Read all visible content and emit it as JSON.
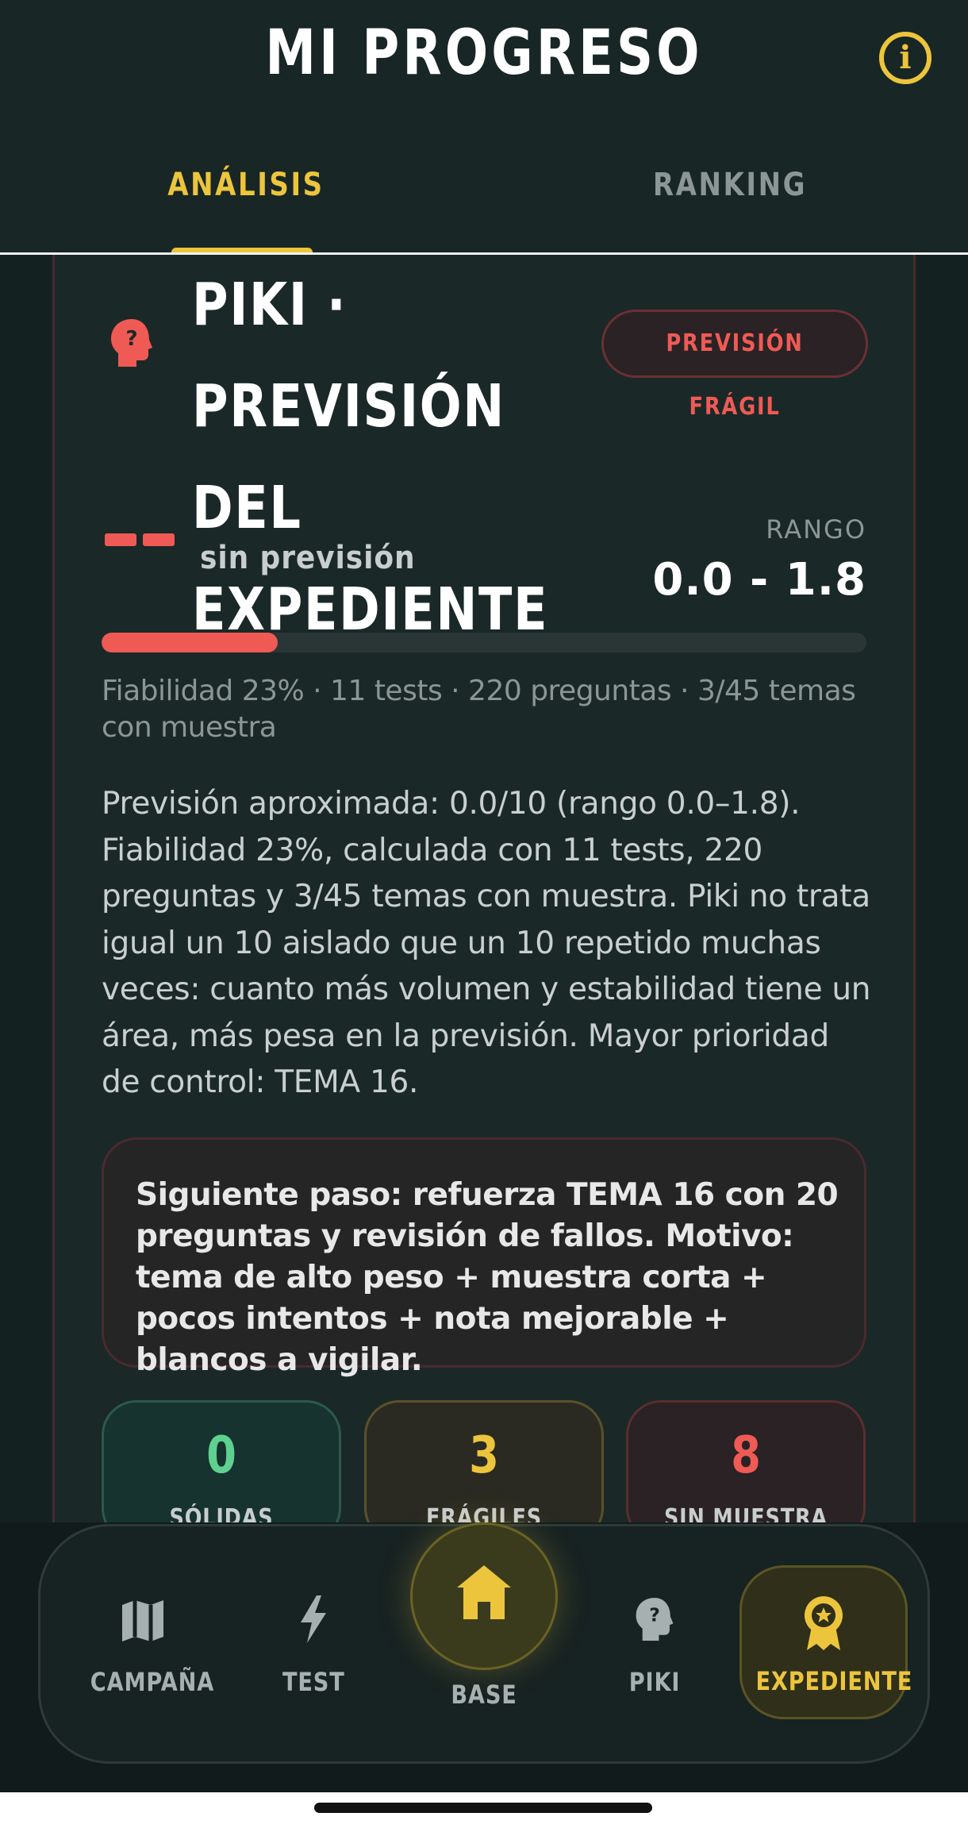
{
  "header": {
    "title": "MI PROGRESO",
    "info_icon": "info-icon",
    "tabs": [
      {
        "label": "ANÁLISIS",
        "active": true
      },
      {
        "label": "RANKING",
        "active": false
      }
    ]
  },
  "card": {
    "icon": "head-question-icon",
    "title_line1": "PIKI · PREVISIÓN",
    "title_line2": "DEL EXPEDIENTE",
    "badge": "PREVISIÓN FRÁGIL",
    "forecast_label": "sin previsión",
    "range_title": "RANGO",
    "range_value": "0.0 - 1.8",
    "progress_percent": 23,
    "stats_line": "Fiabilidad 23% · 11 tests · 220 preguntas · 3/45 temas con muestra",
    "summary": "Previsión aproximada: 0.0/10 (rango 0.0–1.8). Fiabilidad 23%, calculada con 11 tests, 220 preguntas y 3/45 temas con muestra. Piki no trata igual un 10 aislado que un 10 repetido muchas veces: cuanto más volumen y estabilidad tiene un área, más pesa en la previsión. Mayor prioridad de control: TEMA 16.",
    "next_step": "Siguiente paso: refuerza TEMA 16 con 20 preguntas y revisión de fallos. Motivo: tema de alto peso + muestra corta + pocos intentos + nota mejorable + blancos a vigilar.",
    "stats": [
      {
        "value": "0",
        "label": "SÓLIDAS",
        "color": "#5fd18f"
      },
      {
        "value": "3",
        "label": "FRÁGILES",
        "color": "#ecc53c"
      },
      {
        "value": "8",
        "label": "SIN MUESTRA",
        "color": "#ef5a55"
      }
    ]
  },
  "nav": {
    "items": [
      {
        "label": "CAMPAÑA",
        "icon": "map-icon"
      },
      {
        "label": "TEST",
        "icon": "lightning-icon"
      },
      {
        "label": "BASE",
        "icon": "home-icon"
      },
      {
        "label": "PIKI",
        "icon": "head-question-icon"
      },
      {
        "label": "EXPEDIENTE",
        "icon": "award-medal-icon",
        "active": true
      }
    ]
  },
  "colors": {
    "accent": "#ecc53c",
    "danger": "#ef5a55",
    "success": "#5fd18f",
    "background": "#142121"
  }
}
